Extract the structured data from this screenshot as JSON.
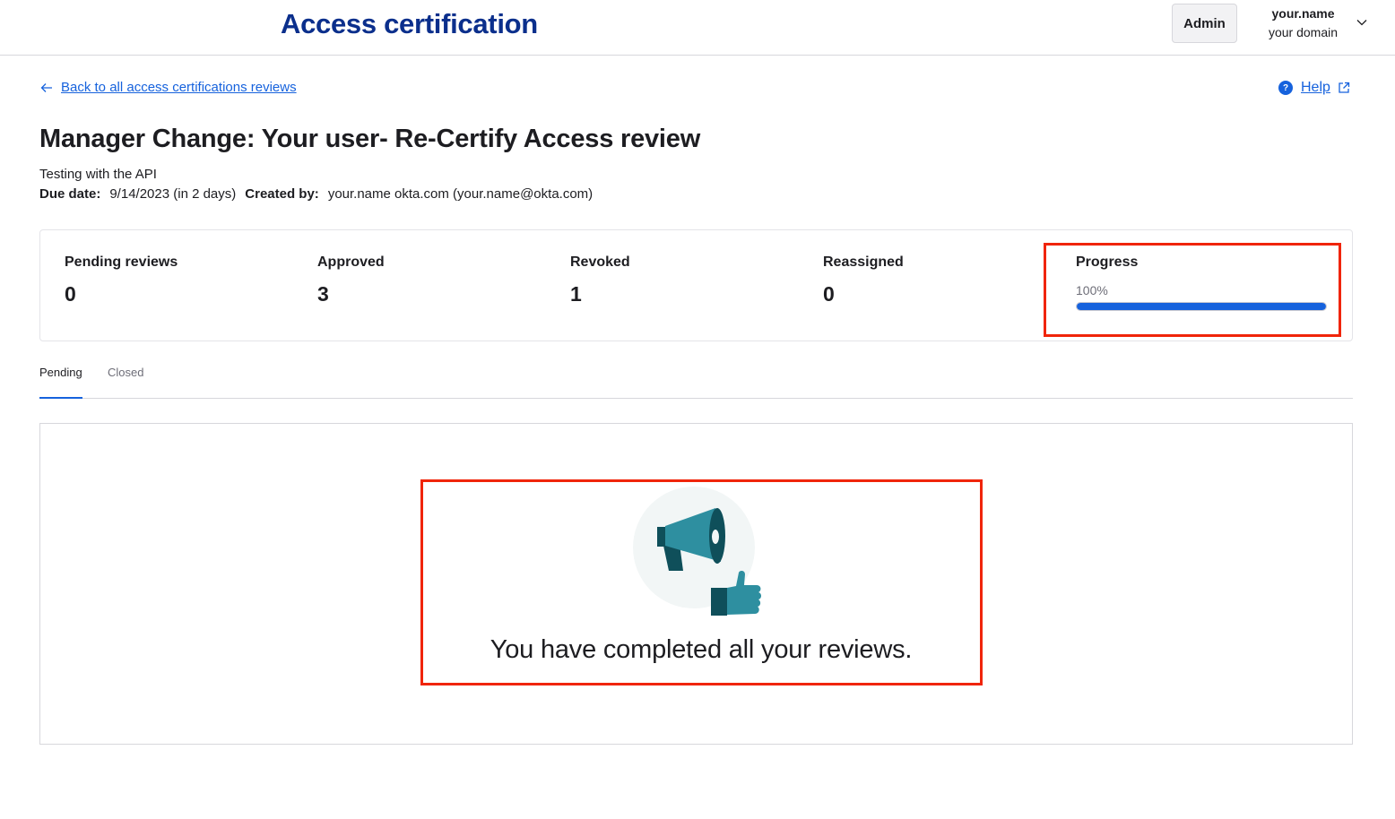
{
  "header": {
    "app_title": "Access certification",
    "admin_label": "Admin",
    "user_name": "your.name",
    "user_domain": "your domain"
  },
  "nav": {
    "back_label": "Back to all access certifications reviews",
    "help_label": "Help"
  },
  "review": {
    "title": "Manager Change: Your user- Re-Certify Access review",
    "description": "Testing with the API",
    "due_date_label": "Due date:",
    "due_date_value": "9/14/2023 (in 2 days)",
    "created_by_label": "Created by:",
    "created_by_value": "your.name okta.com (your.name@okta.com)"
  },
  "stats": {
    "pending_label": "Pending reviews",
    "pending_value": "0",
    "approved_label": "Approved",
    "approved_value": "3",
    "revoked_label": "Revoked",
    "revoked_value": "1",
    "reassigned_label": "Reassigned",
    "reassigned_value": "0",
    "progress_label": "Progress",
    "progress_text": "100%",
    "progress_fraction": 1.0
  },
  "tabs": [
    {
      "label": "Pending",
      "active": true
    },
    {
      "label": "Closed",
      "active": false
    }
  ],
  "empty_state": {
    "message": "You have completed all your reviews.",
    "icon": "megaphone-thumbs-up-illustration"
  },
  "colors": {
    "brand_title": "#0b2f8c",
    "link": "#1662dd",
    "highlight": "#f0250a",
    "illustration_teal": "#2e8fa0",
    "illustration_dark": "#0f4f5a"
  }
}
